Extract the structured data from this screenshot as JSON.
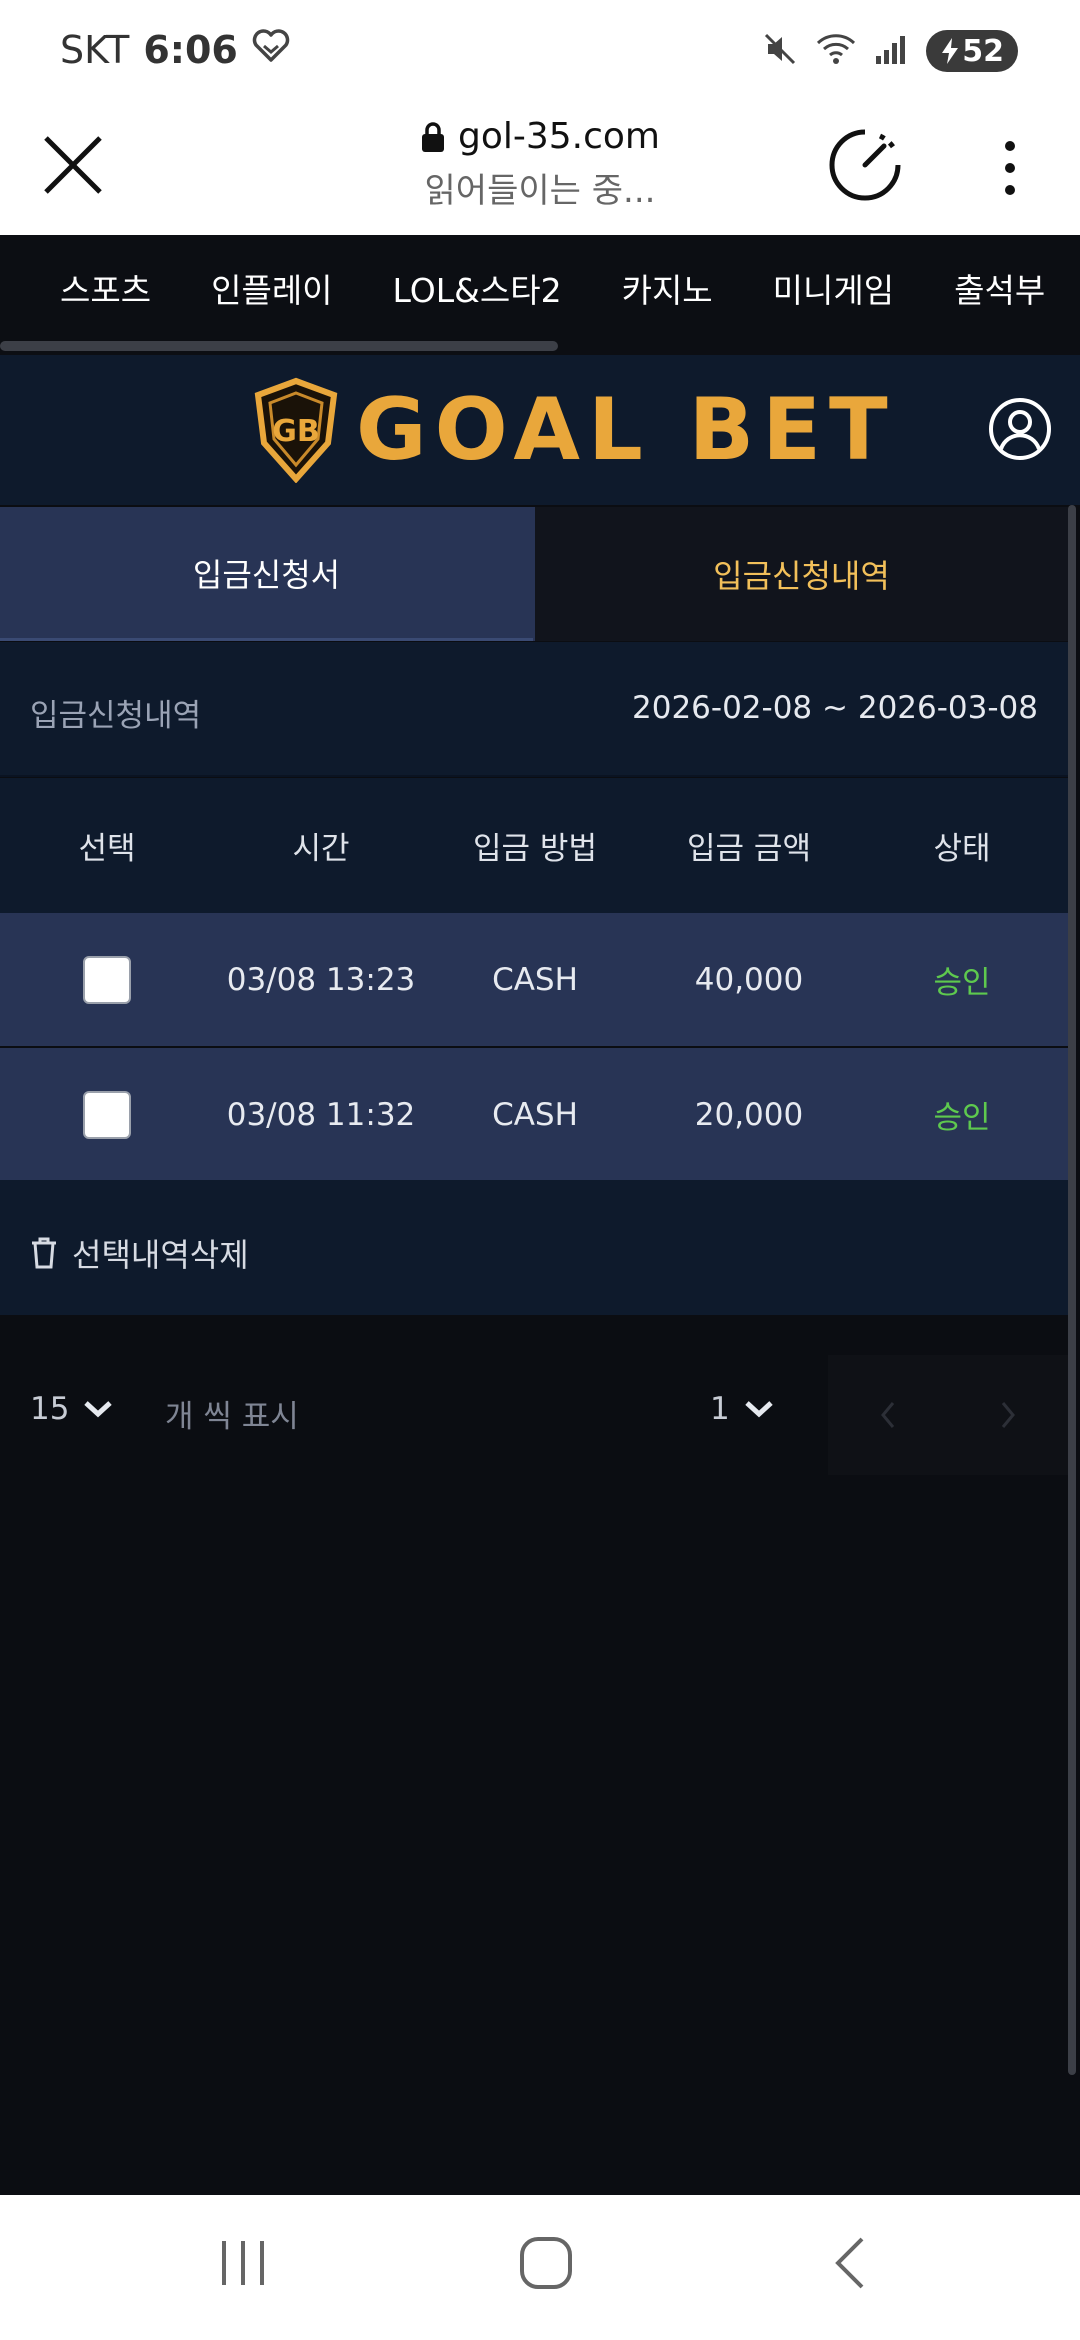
{
  "status_bar": {
    "carrier": "SKT",
    "time": "6:06",
    "battery": "52"
  },
  "browser": {
    "url": "gol-35.com",
    "loading_text": "읽어들이는 중..."
  },
  "category_nav": [
    "스포츠",
    "인플레이",
    "LOL&스타2",
    "카지노",
    "미니게임",
    "출석부"
  ],
  "header": {
    "logo_text": "GOAL BET",
    "brand_color": "#e9a73b"
  },
  "tabs": {
    "deposit_form": "입금신청서",
    "deposit_history": "입금신청내역"
  },
  "range": {
    "label": "입금신청내역",
    "dates": "2026-02-08 ~ 2026-03-08"
  },
  "table": {
    "headers": [
      "선택",
      "시간",
      "입금 방법",
      "입금 금액",
      "상태"
    ],
    "rows": [
      {
        "time": "03/08 13:23",
        "method": "CASH",
        "amount": "40,000",
        "status": "승인"
      },
      {
        "time": "03/08 11:32",
        "method": "CASH",
        "amount": "20,000",
        "status": "승인"
      }
    ]
  },
  "actions": {
    "delete_selected": "선택내역삭제"
  },
  "pager": {
    "per_page": "15",
    "per_page_label": "개 씩 표시",
    "page": "1"
  }
}
